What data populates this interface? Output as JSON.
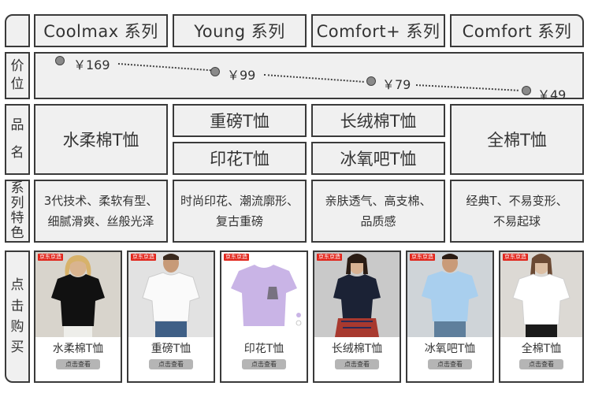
{
  "row_labels": {
    "price": [
      "价",
      "位"
    ],
    "name": [
      "品",
      "名"
    ],
    "features": [
      "系",
      "列",
      "特",
      "色"
    ],
    "buy": [
      "点",
      "击",
      "购",
      "买"
    ]
  },
  "series": [
    {
      "header": "Coolmax 系列",
      "price": "￥169",
      "names": [
        "水柔棉T恤"
      ],
      "features": [
        "3代技术、柔软有型、",
        "细腻滑爽、丝般光泽"
      ]
    },
    {
      "header": "Young 系列",
      "price": "￥99",
      "names": [
        "重磅T恤",
        "印花T恤"
      ],
      "features": [
        "时尚印花、潮流廓形、",
        "复古重磅"
      ]
    },
    {
      "header": "Comfort+ 系列",
      "price": "￥79",
      "names": [
        "长绒棉T恤",
        "冰氧吧T恤"
      ],
      "features": [
        "亲肤透气、高支棉、",
        "品质感"
      ]
    },
    {
      "header": "Comfort 系列",
      "price": "￥49",
      "names": [
        "全棉T恤"
      ],
      "features": [
        "经典T、不易变形、",
        "不易起球"
      ]
    }
  ],
  "products": [
    {
      "title": "水柔棉T恤",
      "button": "点击查看",
      "badge": "京东京造",
      "shirt_color": "#111111",
      "bg": "#d8d4cc"
    },
    {
      "title": "重磅T恤",
      "button": "点击查看",
      "badge": "京东京造",
      "shirt_color": "#fafafa",
      "bg": "#e2e2e2"
    },
    {
      "title": "印花T恤",
      "button": "点击查看",
      "badge": "京东京造",
      "shirt_color": "#c9b4e6",
      "bg": "#ffffff"
    },
    {
      "title": "长绒棉T恤",
      "button": "点击查看",
      "badge": "京东京造",
      "shirt_color": "#1b2235",
      "bg": "#c9c9c9"
    },
    {
      "title": "冰氧吧T恤",
      "button": "点击查看",
      "badge": "京东京造",
      "shirt_color": "#a9cfee",
      "bg": "#cfd4d8"
    },
    {
      "title": "全棉T恤",
      "button": "点击查看",
      "badge": "京东京造",
      "shirt_color": "#ffffff",
      "bg": "#dcd9d4"
    }
  ]
}
